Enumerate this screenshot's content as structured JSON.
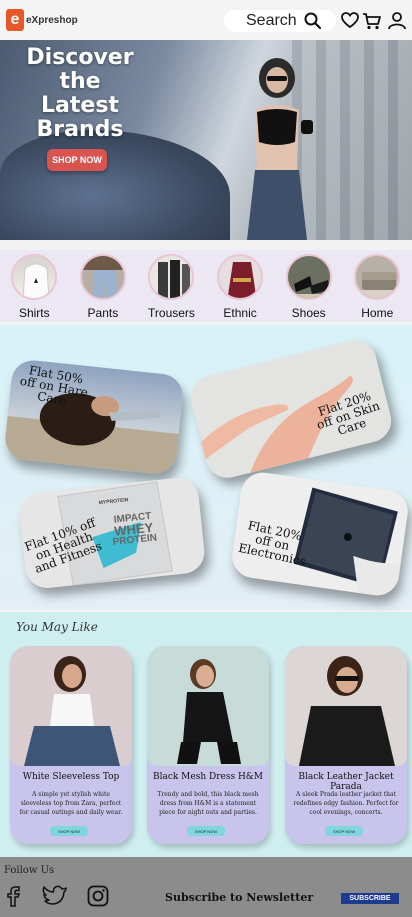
{
  "header": {
    "logo_letter": "e",
    "logo_text": "eXpreshop",
    "search_placeholder": "Search",
    "icons": [
      "search-icon",
      "heart-icon",
      "cart-icon",
      "user-icon"
    ]
  },
  "hero": {
    "title": "Discover the Latest Brands",
    "cta": "SHOP NOW"
  },
  "categories": [
    {
      "label": "Shirts"
    },
    {
      "label": "Pants"
    },
    {
      "label": "Trousers"
    },
    {
      "label": "Ethnic"
    },
    {
      "label": "Shoes"
    },
    {
      "label": "Home"
    }
  ],
  "offers": {
    "hair": "Flat 50% off on Hare Care",
    "skin": "Flat 20% off on Skin Care",
    "health": "Flat 10% off on Health and Fitness",
    "electronics": "Flat 20% off on Electronics",
    "whey_brand": "MYPROTEIN",
    "whey_line1": "IMPACT",
    "whey_line2": "WHEY",
    "whey_line3": "PROTEIN"
  },
  "you_may_like": {
    "title": "You May Like",
    "products": [
      {
        "name": "White Sleeveless Top",
        "desc": "A simple yet stylish white sleeveless top from Zara, perfect for casual outings and daily wear.",
        "button": "SHOP NOW"
      },
      {
        "name": "Black Mesh Dress H&M",
        "desc": "Trendy and bold, this black mesh dress from H&M is a statement piece for night outs and parties.",
        "button": "SHOP NOW"
      },
      {
        "name": "Black Leather Jacket Parada",
        "desc": "A sleek Prada leather jacket that redefines edgy fashion. Perfect for cool evenings, concerts.",
        "button": "SHOP NOW"
      }
    ]
  },
  "footer": {
    "follow": "Follow Us",
    "social": [
      "facebook-icon",
      "twitter-icon",
      "instagram-icon"
    ],
    "subscribe_text": "Subscribe to Newsletter",
    "subscribe_button": "SUBSCRIBE"
  }
}
